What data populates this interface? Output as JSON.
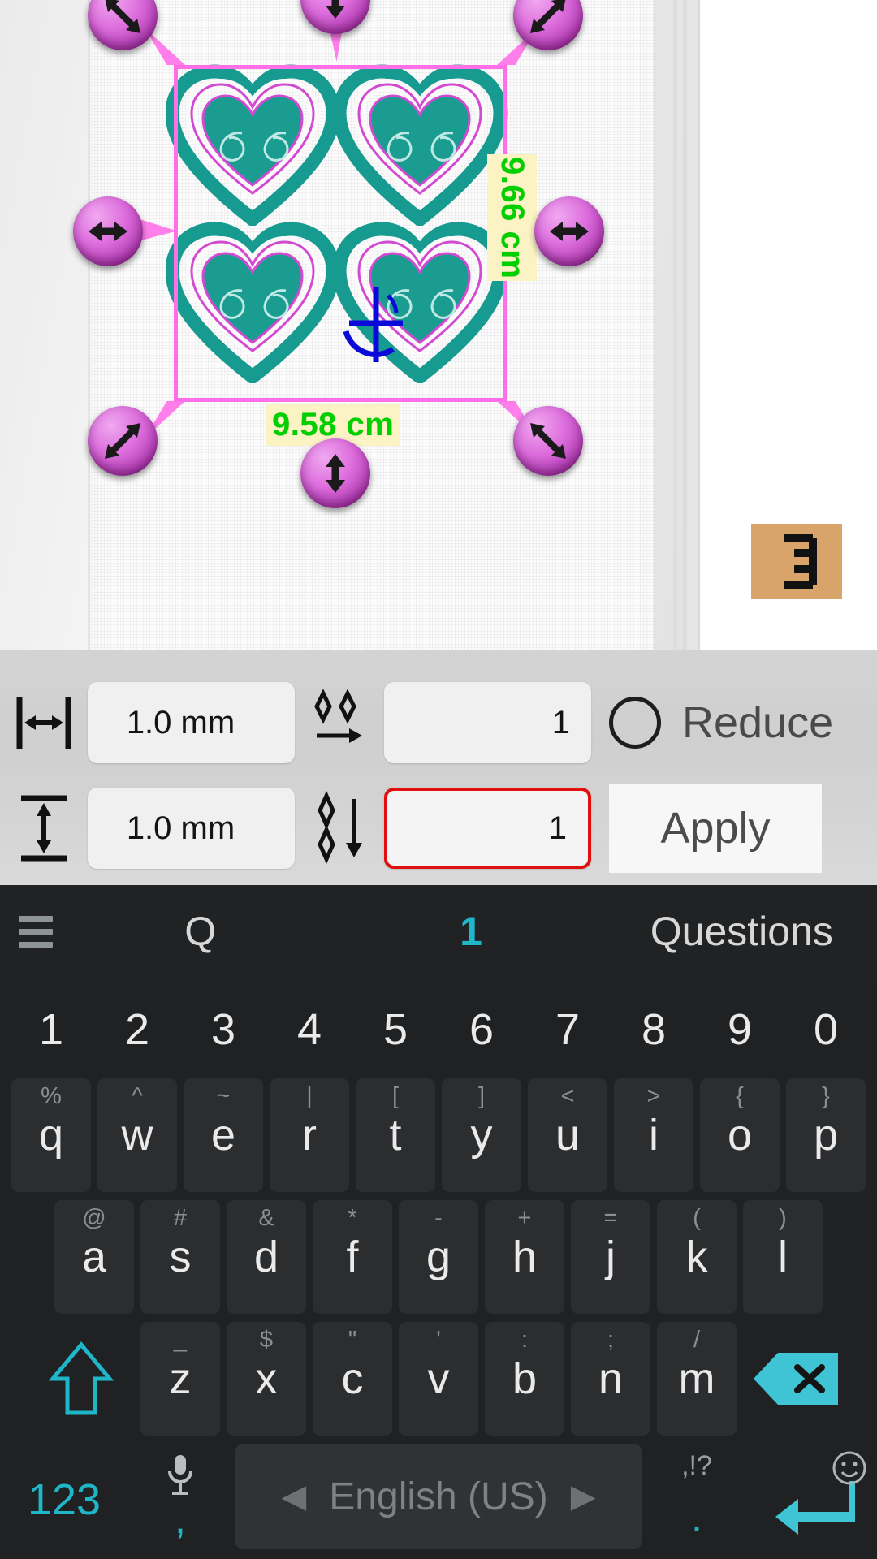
{
  "design": {
    "width_label": "9.58 cm",
    "height_label": "9.66 cm",
    "selection_color": "#ff6fe8",
    "dim_text_color": "#00d000",
    "dim_bg_color": "#fbf3c4",
    "thread_colors": [
      "#1e9e92",
      "#f2f2f2",
      "#d24ad2"
    ],
    "motif_count": 4,
    "handles": [
      {
        "name": "resize-top-left",
        "icon": "arrow-diagonal-nwse-icon"
      },
      {
        "name": "resize-top-center",
        "icon": "arrow-vertical-icon"
      },
      {
        "name": "resize-top-right",
        "icon": "arrow-diagonal-nesw-icon"
      },
      {
        "name": "resize-middle-left",
        "icon": "arrow-horizontal-icon"
      },
      {
        "name": "resize-middle-right",
        "icon": "arrow-horizontal-icon"
      },
      {
        "name": "resize-bottom-left",
        "icon": "arrow-diagonal-nesw-icon"
      },
      {
        "name": "resize-bottom-center",
        "icon": "arrow-vertical-icon"
      },
      {
        "name": "resize-bottom-right",
        "icon": "arrow-diagonal-nwse-icon"
      }
    ],
    "ruler_badge": {
      "name": "ruler-icon",
      "bg": "#d9a469"
    }
  },
  "controls": {
    "row1": {
      "icon": "horizontal-spacing-icon",
      "spacing_value": "1.0 mm",
      "repeat_icon": "duplicate-horizontal-icon",
      "count_value": "1",
      "reduce_label": "Reduce",
      "reduce_checked": false
    },
    "row2": {
      "icon": "vertical-spacing-icon",
      "spacing_value": "1.0 mm",
      "repeat_icon": "duplicate-vertical-icon",
      "count_value": "1",
      "count_focused": true,
      "apply_label": "Apply"
    }
  },
  "keyboard": {
    "suggestions": {
      "menu_icon": "hamburger-menu-icon",
      "items": [
        {
          "label": "Q",
          "selected": false
        },
        {
          "label": "1",
          "selected": true
        },
        {
          "label": "Questions",
          "selected": false
        }
      ],
      "accent_color": "#1fb6c9"
    },
    "number_row": [
      "1",
      "2",
      "3",
      "4",
      "5",
      "6",
      "7",
      "8",
      "9",
      "0"
    ],
    "row1": [
      {
        "key": "q",
        "sup": "%"
      },
      {
        "key": "w",
        "sup": "^"
      },
      {
        "key": "e",
        "sup": "~"
      },
      {
        "key": "r",
        "sup": "|"
      },
      {
        "key": "t",
        "sup": "["
      },
      {
        "key": "y",
        "sup": "]"
      },
      {
        "key": "u",
        "sup": "<"
      },
      {
        "key": "i",
        "sup": ">"
      },
      {
        "key": "o",
        "sup": "{"
      },
      {
        "key": "p",
        "sup": "}"
      }
    ],
    "row2": [
      {
        "key": "a",
        "sup": "@"
      },
      {
        "key": "s",
        "sup": "#"
      },
      {
        "key": "d",
        "sup": "&"
      },
      {
        "key": "f",
        "sup": "*"
      },
      {
        "key": "g",
        "sup": "-"
      },
      {
        "key": "h",
        "sup": "+"
      },
      {
        "key": "j",
        "sup": "="
      },
      {
        "key": "k",
        "sup": "("
      },
      {
        "key": "l",
        "sup": ")"
      }
    ],
    "row3": {
      "shift_icon": "shift-arrow-icon",
      "keys": [
        {
          "key": "z",
          "sup": "_"
        },
        {
          "key": "x",
          "sup": "$"
        },
        {
          "key": "c",
          "sup": "\""
        },
        {
          "key": "v",
          "sup": "'"
        },
        {
          "key": "b",
          "sup": ":"
        },
        {
          "key": "n",
          "sup": ";"
        },
        {
          "key": "m",
          "sup": "/"
        }
      ],
      "backspace_icon": "backspace-icon",
      "backspace_label": "x"
    },
    "row4": {
      "numeric_label": "123",
      "comma_label": ",",
      "mic_icon": "microphone-icon",
      "space_label": "English (US)",
      "left_arrow": "◀",
      "right_arrow": "▶",
      "period_label": ".",
      "punct_label": ",!?",
      "emoji_icon": "emoji-smiley-icon",
      "enter_icon": "enter-return-icon"
    }
  }
}
